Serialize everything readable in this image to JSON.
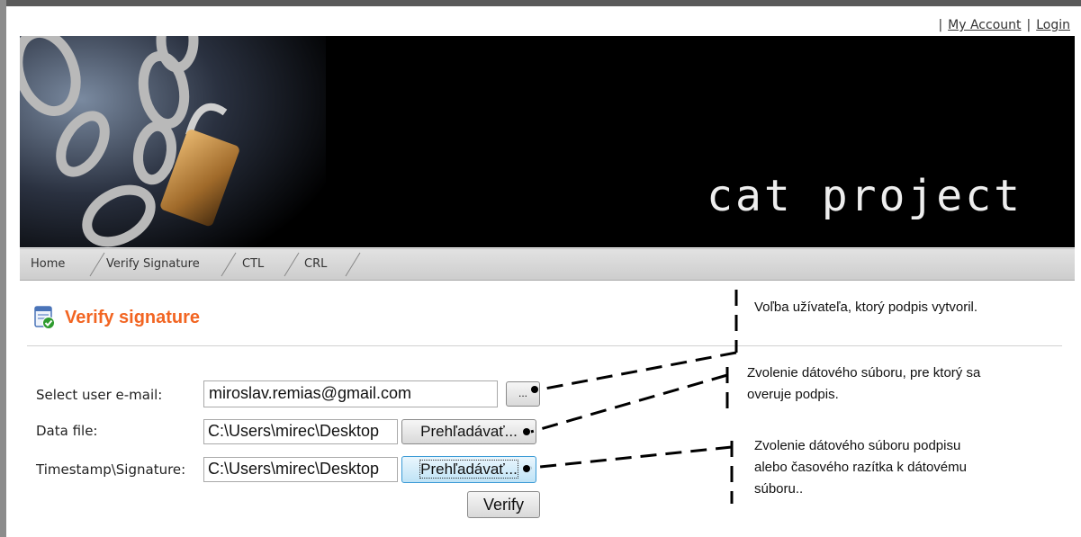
{
  "top_links": {
    "sep": "|",
    "my_account": "My Account",
    "login": "Login"
  },
  "banner": {
    "title": "cat project"
  },
  "nav": {
    "items": [
      "Home",
      "Verify Signature",
      "CTL",
      "CRL"
    ]
  },
  "page": {
    "heading": "Verify signature"
  },
  "form": {
    "email_label": "Select user e-mail:",
    "email_value": "miroslav.remias@gmail.com",
    "email_button": "...",
    "data_label": "Data file:",
    "data_value": "C:\\Users\\mirec\\Desktop",
    "data_button": "Prehľadávať...",
    "sig_label": "Timestamp\\Signature:",
    "sig_value": "C:\\Users\\mirec\\Desktop",
    "sig_button": "Prehľadávať...",
    "verify_button": "Verify"
  },
  "annotations": {
    "note1": "Voľba užívateľa, ktorý podpis vytvoril.",
    "note2_line1": "Zvolenie dátového súboru, pre ktorý sa",
    "note2_line2": "overuje podpis.",
    "note3_line1": "Zvolenie dátového súboru podpisu",
    "note3_line2": "alebo časového razítka k dátovému",
    "note3_line3": "súboru.."
  }
}
